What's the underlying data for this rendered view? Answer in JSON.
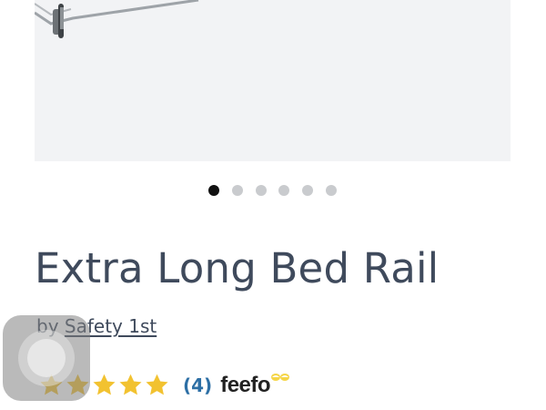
{
  "product": {
    "title": "Extra Long Bed Rail",
    "by_label": "by",
    "brand": "Safety 1st"
  },
  "gallery": {
    "image_count": 6,
    "active_index": 0
  },
  "rating": {
    "stars": 5,
    "review_count": "(4)",
    "provider": "feefo"
  },
  "colors": {
    "star": "#f2c230",
    "title_text": "#3f4a5c",
    "review_count": "#2d6fa5",
    "dot_active": "#111111",
    "dot_inactive": "#c9cbce"
  },
  "icons": {
    "star": "star-icon",
    "overlay": "assistive-touch-icon"
  }
}
